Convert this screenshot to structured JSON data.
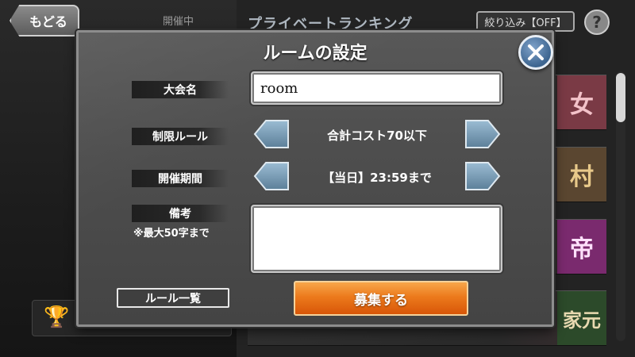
{
  "background": {
    "back_label": "もどる",
    "tab_label": "開催中",
    "ranking_title": "プライベートランキング",
    "filter_label": "絞り込み【OFF】",
    "help_label": "?",
    "cards": [
      {
        "thumb": "女",
        "color": "#f3c2c9"
      },
      {
        "thumb": "村",
        "color": "#e8c98a"
      },
      {
        "thumb": "帝",
        "color": "#e06bd0"
      },
      {
        "thumb": "家元",
        "color": "#e8d9b0"
      }
    ]
  },
  "modal": {
    "title": "ルームの設定",
    "close_icon": "close-icon",
    "fields": {
      "tournament_name": {
        "label": "大会名",
        "value": "room"
      },
      "restriction_rule": {
        "label": "制限ルール",
        "value": "合計コスト70以下"
      },
      "period": {
        "label": "開催期間",
        "value": "【当日】23:59まで"
      },
      "notes": {
        "label": "備考",
        "sublabel": "※最大50字まで",
        "value": ""
      }
    },
    "rules_button": "ルール一覧",
    "recruit_button": "募集する"
  },
  "colors": {
    "accent_orange": "#ec7a1c",
    "arrow_blue": "#6f94b0",
    "close_blue": "#3d6590"
  }
}
